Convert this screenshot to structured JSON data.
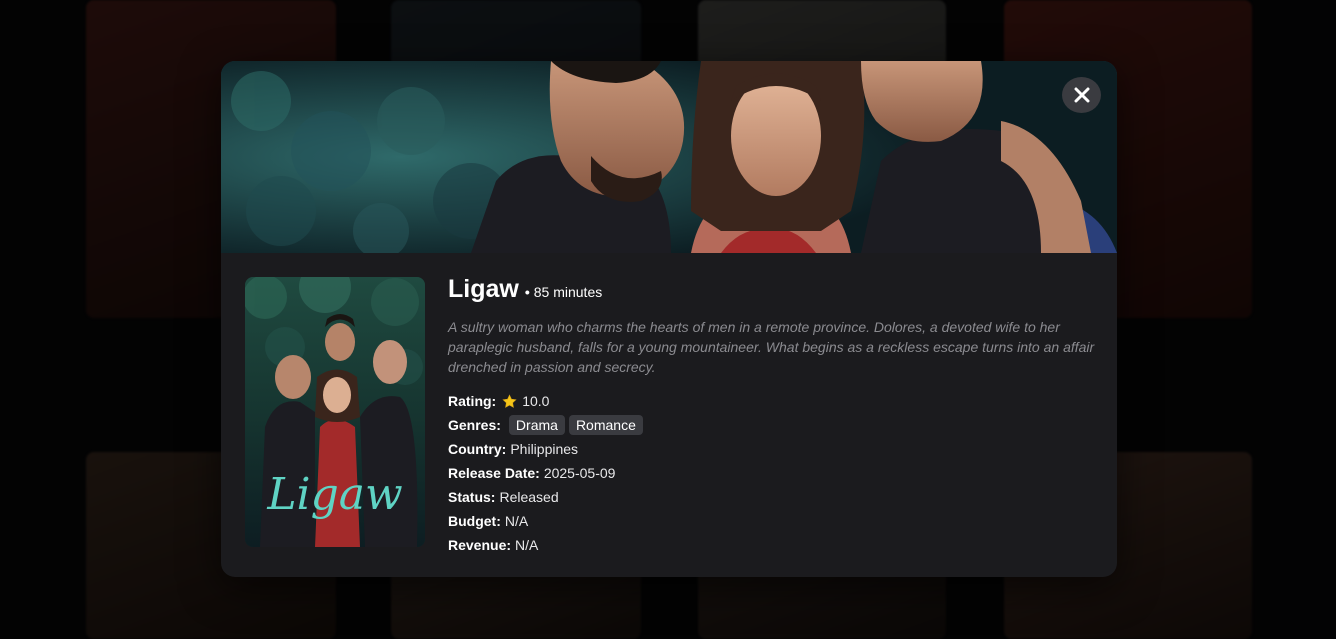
{
  "modal": {
    "close_label": "",
    "title": "Ligaw",
    "separator": "•",
    "runtime": "85 minutes",
    "overview": "A sultry woman who charms the hearts of men in a remote province. Dolores, a devoted wife to her paraplegic husband, falls for a young mountaineer. What begins as a reckless escape turns into an affair drenched in passion and secrecy.",
    "poster_title": "Ligaw",
    "rating_label": "Rating:",
    "rating_value": "10.0",
    "genres_label": "Genres:",
    "genres": [
      "Drama",
      "Romance"
    ],
    "country_label": "Country:",
    "country_value": "Philippines",
    "release_label": "Release Date:",
    "release_value": "2025-05-09",
    "status_label": "Status:",
    "status_value": "Released",
    "budget_label": "Budget:",
    "budget_value": "N/A",
    "revenue_label": "Revenue:",
    "revenue_value": "N/A"
  },
  "icons": {
    "close": "close-icon",
    "star": "star-icon"
  },
  "colors": {
    "modal_bg": "#1b1b1e",
    "chip_bg": "#3a3b40",
    "overview_text": "#8b8b90",
    "star": "#f5c518",
    "poster_title": "#5fd3c4"
  }
}
